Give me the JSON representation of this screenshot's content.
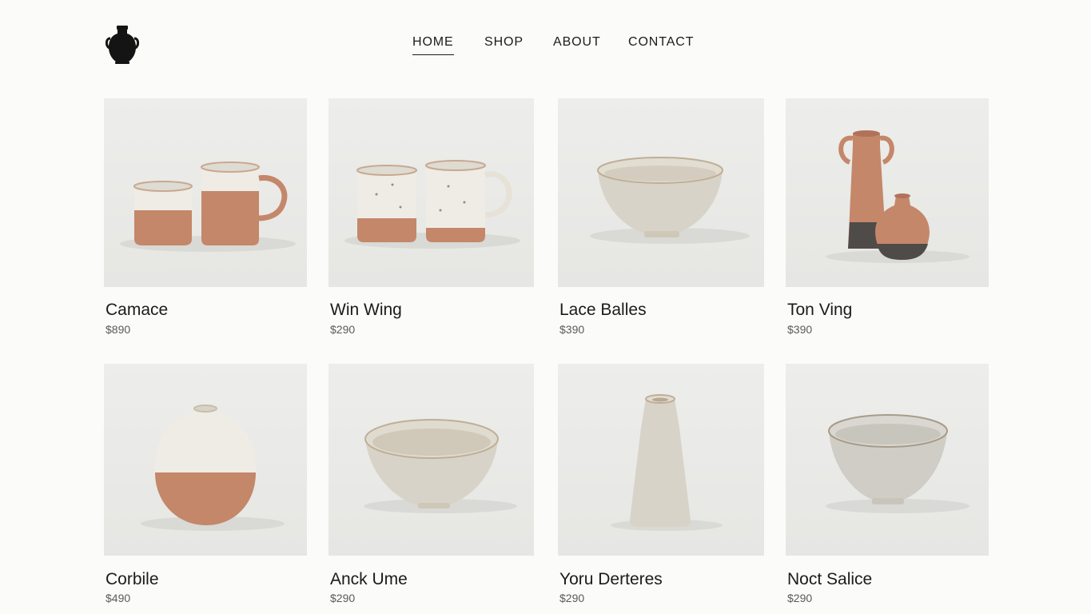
{
  "nav": {
    "items": [
      {
        "label": "HOME",
        "active": true
      },
      {
        "label": "SHOP",
        "active": false
      },
      {
        "label": "ABOUT",
        "active": false
      },
      {
        "label": "CONTACT",
        "active": false
      }
    ]
  },
  "logo": {
    "icon": "vase-icon"
  },
  "colors": {
    "clay": "#c4876a",
    "glaze_white": "#eeece5",
    "speckle_glaze": "#d8d3c8",
    "charcoal": "#4f4b49",
    "text": "#1b1b1b"
  },
  "products": [
    {
      "name": "Camace",
      "price": "$890",
      "illustration": "two-tone-mugs"
    },
    {
      "name": "Win Wing",
      "price": "$290",
      "illustration": "speckled-mugs"
    },
    {
      "name": "Lace Balles",
      "price": "$390",
      "illustration": "speckled-bowl"
    },
    {
      "name": "Ton Ving",
      "price": "$390",
      "illustration": "amphora-and-bud-vase"
    },
    {
      "name": "Corbile",
      "price": "$490",
      "illustration": "moon-jar"
    },
    {
      "name": "Anck Ume",
      "price": "$290",
      "illustration": "deep-bowl"
    },
    {
      "name": "Yoru Derteres",
      "price": "$290",
      "illustration": "bottle-vase"
    },
    {
      "name": "Noct Salice",
      "price": "$290",
      "illustration": "grey-bowl"
    }
  ]
}
